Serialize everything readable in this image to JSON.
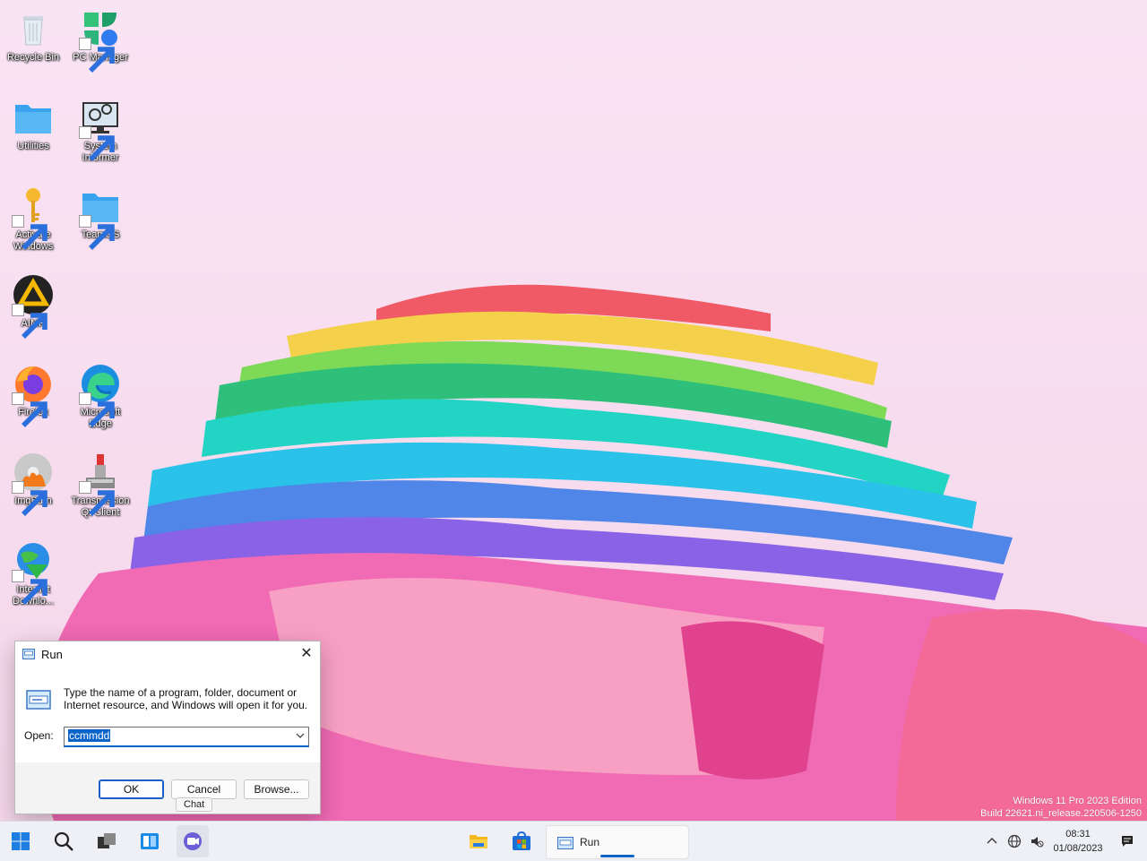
{
  "desktop": {
    "icons": [
      {
        "label": "Recycle Bin"
      },
      {
        "label": "PC Manager"
      },
      {
        "label": "Utilities"
      },
      {
        "label": "System Informer"
      },
      {
        "label": "Activate Windows"
      },
      {
        "label": "TeamOS"
      },
      {
        "label": "AIMP"
      },
      {
        "label": "Firefox"
      },
      {
        "label": "Microsoft Edge"
      },
      {
        "label": "ImgBurn"
      },
      {
        "label": "Transmission Qt Client"
      },
      {
        "label": "Internet Downlo..."
      }
    ]
  },
  "run_dialog": {
    "title": "Run",
    "description": "Type the name of a program, folder, document or Internet resource, and Windows will open it for you.",
    "open_label": "Open:",
    "open_value": "ccmmdd",
    "ok_label": "OK",
    "cancel_label": "Cancel",
    "browse_label": "Browse..."
  },
  "tooltip": {
    "text": "Chat"
  },
  "watermark": {
    "line1": "Windows 11 Pro 2023 Edition",
    "line2": "Build 22621.ni_release.220506-1250"
  },
  "taskbar": {
    "run_label": "Run",
    "time": "08:31",
    "date": "01/08/2023"
  },
  "colors": {
    "accent": "#0a63c9",
    "taskbar_bg": "#eef0f6",
    "wallpaper_bg": "#f6dcef"
  }
}
